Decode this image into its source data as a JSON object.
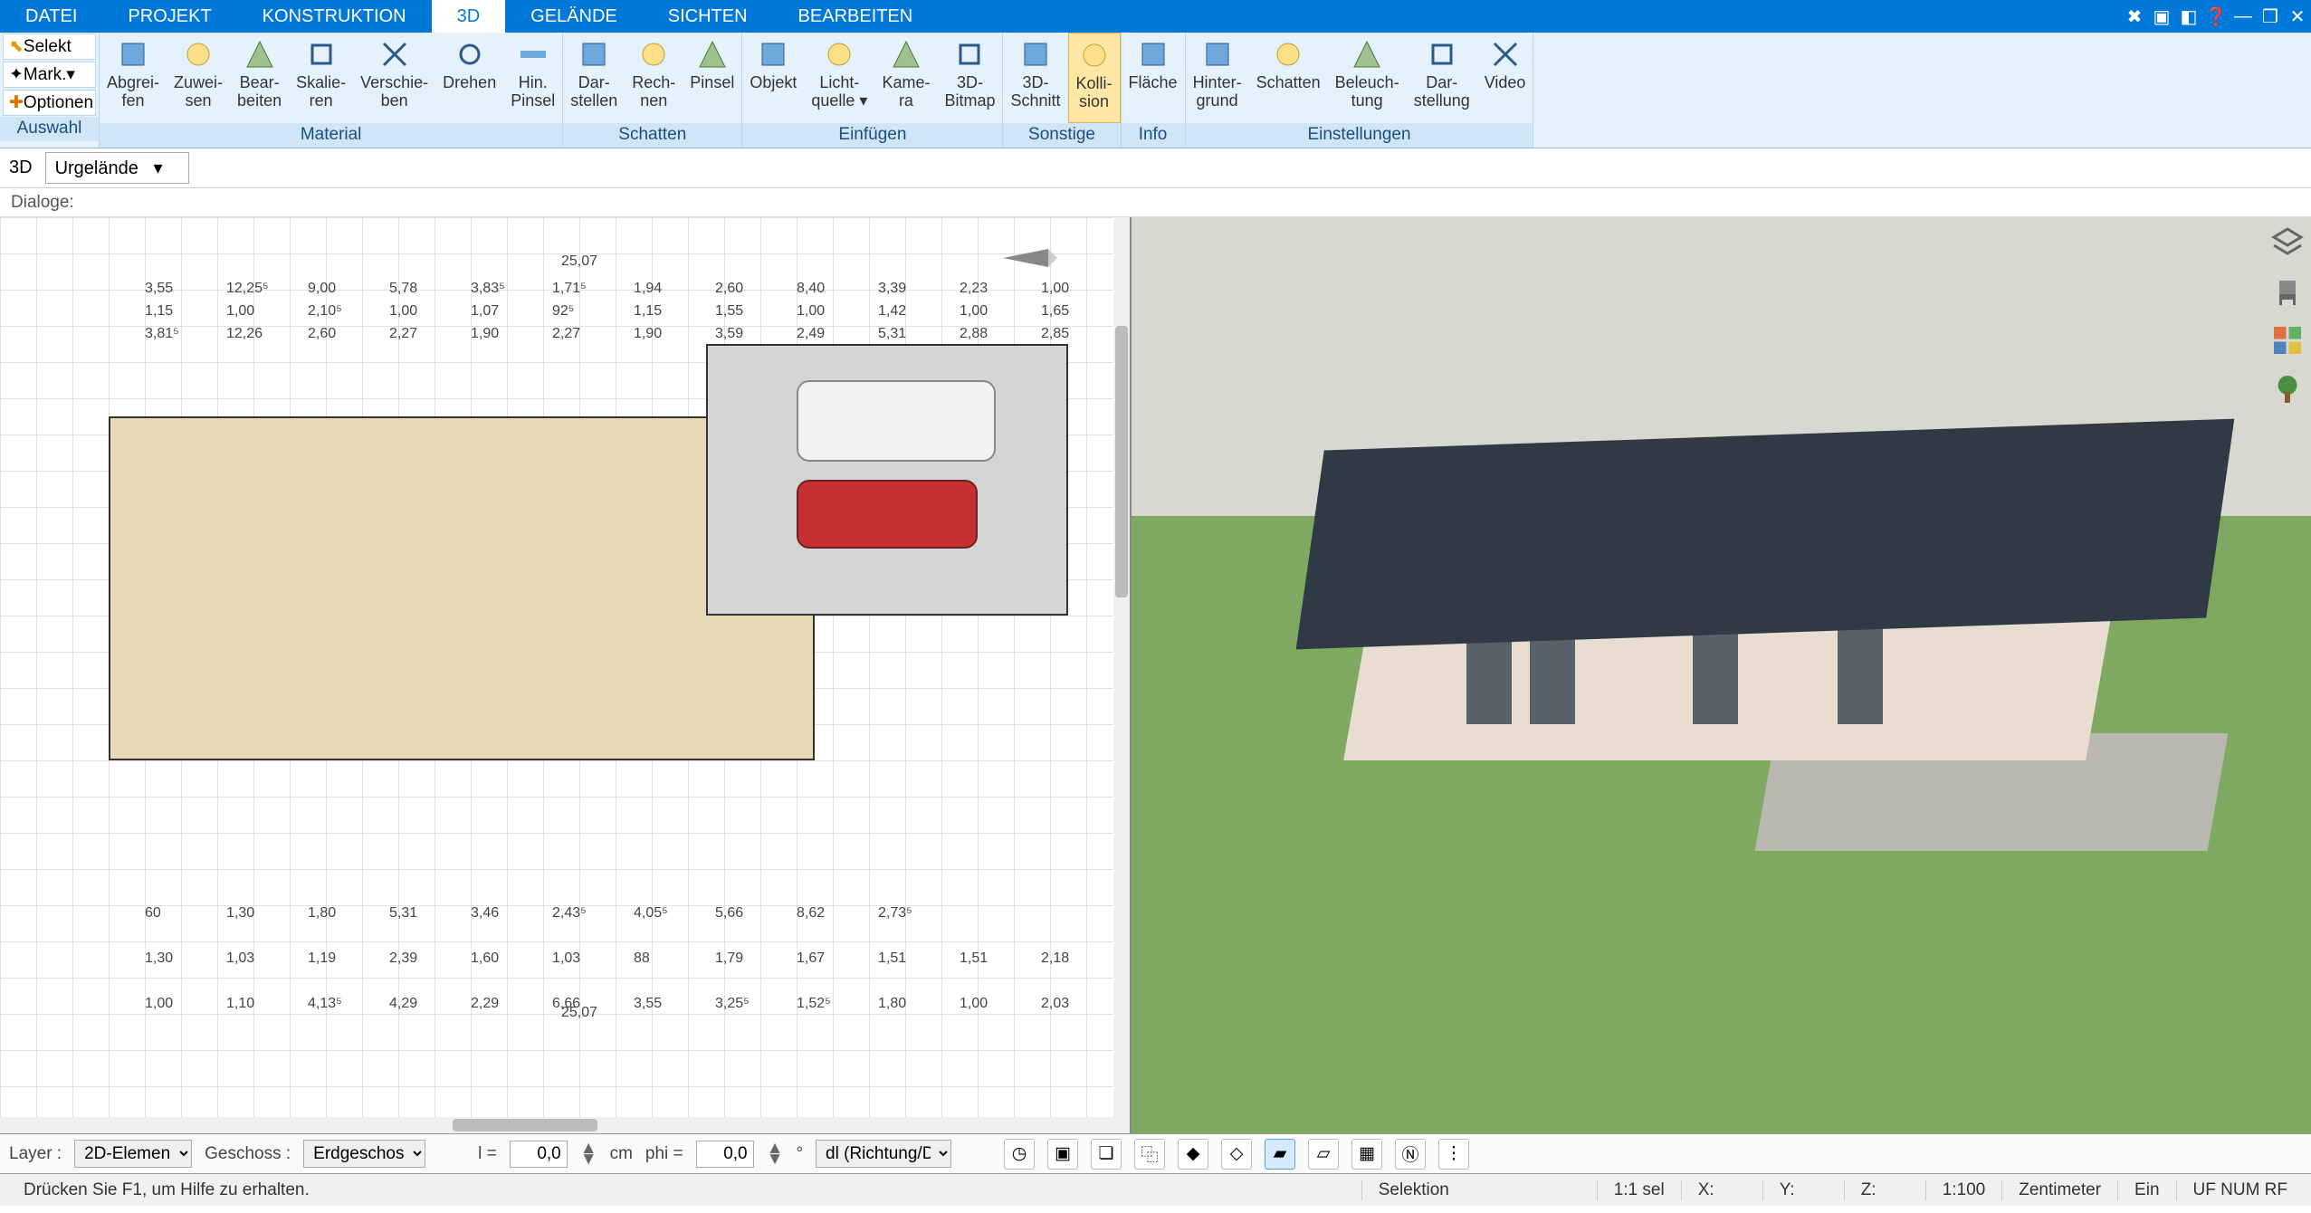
{
  "menu": {
    "tabs": [
      "DATEI",
      "PROJEKT",
      "KONSTRUKTION",
      "3D",
      "GELÄNDE",
      "SICHTEN",
      "BEARBEITEN"
    ],
    "active": "3D"
  },
  "selection_panel": {
    "title": "Auswahl",
    "select": "Selekt",
    "mark": "Mark.",
    "options": "Optionen"
  },
  "ribbon_groups": [
    {
      "title": "Material",
      "items": [
        {
          "label": "Abgrei-\nfen"
        },
        {
          "label": "Zuwei-\nsen"
        },
        {
          "label": "Bear-\nbeiten"
        },
        {
          "label": "Skalie-\nren"
        },
        {
          "label": "Verschie-\nben"
        },
        {
          "label": "Drehen"
        },
        {
          "label": "Hin.\nPinsel"
        }
      ]
    },
    {
      "title": "Schatten",
      "items": [
        {
          "label": "Dar-\nstellen"
        },
        {
          "label": "Rech-\nnen"
        },
        {
          "label": "Pinsel"
        }
      ]
    },
    {
      "title": "Einfügen",
      "items": [
        {
          "label": "Objekt"
        },
        {
          "label": "Licht-\nquelle ▾"
        },
        {
          "label": "Kame-\nra"
        },
        {
          "label": "3D-\nBitmap"
        }
      ]
    },
    {
      "title": "Sonstige",
      "items": [
        {
          "label": "3D-\nSchnitt"
        },
        {
          "label": "Kolli-\nsion",
          "active": true
        }
      ]
    },
    {
      "title": "Info",
      "items": [
        {
          "label": "Fläche"
        }
      ]
    },
    {
      "title": "Einstellungen",
      "items": [
        {
          "label": "Hinter-\ngrund"
        },
        {
          "label": "Schatten"
        },
        {
          "label": "Beleuch-\ntung"
        },
        {
          "label": "Dar-\nstellung"
        },
        {
          "label": "Video"
        }
      ]
    }
  ],
  "context": {
    "view_mode": "3D",
    "terrain": "Urgelände"
  },
  "dialoge_label": "Dialoge:",
  "plan": {
    "total_width": "25,07",
    "dims": [
      "3,55",
      "12,25⁵",
      "9,00",
      "5,78",
      "3,83⁵",
      "1,71⁵",
      "1,94",
      "2,60",
      "8,40",
      "3,39",
      "2,23",
      "1,00",
      "1,15",
      "1,00",
      "2,10⁵",
      "1,00",
      "1,07",
      "92⁵",
      "1,15",
      "1,55",
      "1,00",
      "1,42",
      "1,00",
      "1,65",
      "3,81⁵",
      "12,26",
      "2,60",
      "2,27",
      "1,90",
      "2,27",
      "1,90",
      "3,59",
      "2,49",
      "5,31",
      "2,88",
      "2,85",
      "1,00",
      "1,10",
      "4,13⁵",
      "4,29",
      "2,29",
      "6,66",
      "3,55",
      "3,25⁵",
      "1,52⁵",
      "1,80",
      "1,00",
      "2,03",
      "1,30",
      "1,03",
      "1,19",
      "2,39",
      "1,60",
      "1,03",
      "88",
      "1,79",
      "1,67",
      "1,51",
      "1,51",
      "2,18",
      "60",
      "1,30",
      "1,80",
      "5,31",
      "3,46",
      "2,43⁵",
      "4,05⁵",
      "5,66",
      "8,62",
      "2,73⁵"
    ]
  },
  "side_icons": [
    "layers",
    "chair",
    "palette",
    "tree"
  ],
  "bottom": {
    "layer": "Layer :",
    "layer_value": "2D-Elemen",
    "floor": "Geschoss :",
    "floor_value": "Erdgeschos",
    "l_label": "l =",
    "l_value": "0,0",
    "l_unit": "cm",
    "phi_label": "phi =",
    "phi_value": "0,0",
    "phi_unit": "°",
    "mode": "dl (Richtung/Di",
    "buttons": [
      "clock",
      "camera",
      "stack",
      "copy",
      "rotated-fill",
      "rotated-outline",
      "plane-fill",
      "plane-outline",
      "grid",
      "compass",
      "more"
    ]
  },
  "status": {
    "help": "Drücken Sie F1, um Hilfe zu erhalten.",
    "mode": "Selektion",
    "sel": "1:1 sel",
    "x": "X:",
    "y": "Y:",
    "z": "Z:",
    "scale": "1:100",
    "unit": "Zentimeter",
    "ins": "Ein",
    "caps": "UF NUM RF"
  }
}
